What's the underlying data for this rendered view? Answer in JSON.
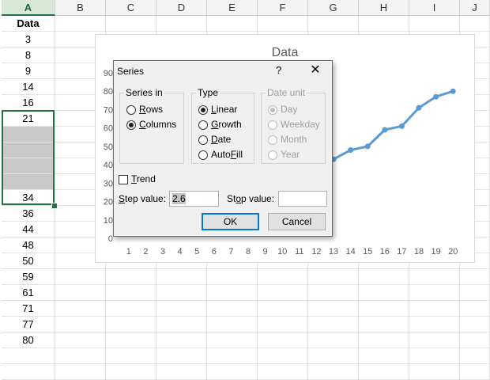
{
  "columns": [
    "A",
    "B",
    "C",
    "D",
    "E",
    "F",
    "G",
    "H",
    "I",
    "J"
  ],
  "column_a": {
    "header": "Data",
    "values": [
      "3",
      "8",
      "9",
      "14",
      "16",
      "21",
      "",
      "",
      "",
      "",
      "34",
      "36",
      "44",
      "48",
      "50",
      "59",
      "61",
      "71",
      "77",
      "80"
    ]
  },
  "chart": {
    "title": "Data",
    "y_ticks": [
      "90",
      "80",
      "70",
      "60",
      "50",
      "40",
      "30",
      "20",
      "10",
      "0"
    ],
    "x_ticks": [
      "1",
      "2",
      "3",
      "4",
      "5",
      "6",
      "7",
      "8",
      "9",
      "10",
      "11",
      "12",
      "13",
      "14",
      "15",
      "16",
      "17",
      "18",
      "19",
      "20"
    ],
    "line_color": "#5b9bd5"
  },
  "chart_data": {
    "type": "line",
    "title": "Data",
    "categories": [
      "1",
      "2",
      "3",
      "4",
      "5",
      "6",
      "7",
      "8",
      "9",
      "10",
      "11",
      "12",
      "13",
      "14",
      "15",
      "16",
      "17",
      "18",
      "19",
      "20"
    ],
    "visible_series_points": [
      {
        "x": 13,
        "y": 43
      },
      {
        "x": 14,
        "y": 48
      },
      {
        "x": 15,
        "y": 50
      },
      {
        "x": 16,
        "y": 59
      },
      {
        "x": 17,
        "y": 61
      },
      {
        "x": 18,
        "y": 71
      },
      {
        "x": 19,
        "y": 77
      },
      {
        "x": 20,
        "y": 80
      }
    ],
    "ylim": [
      0,
      90
    ],
    "grid": false
  },
  "dialog": {
    "title": "Series",
    "help": "?",
    "close": "✕",
    "series_in": {
      "label": "Series in",
      "options": [
        "Rows",
        "Columns"
      ],
      "selected": "Columns"
    },
    "type": {
      "label": "Type",
      "options": [
        "Linear",
        "Growth",
        "Date",
        "AutoFill"
      ],
      "selected": "Linear"
    },
    "date_unit": {
      "label": "Date unit",
      "options": [
        "Day",
        "Weekday",
        "Month",
        "Year"
      ],
      "selected": "Day",
      "enabled": false
    },
    "trend_label": "Trend",
    "step_label": "Step value:",
    "step_value": "2.6",
    "stop_label": "Stop value:",
    "stop_value": "",
    "ok": "OK",
    "cancel": "Cancel"
  }
}
